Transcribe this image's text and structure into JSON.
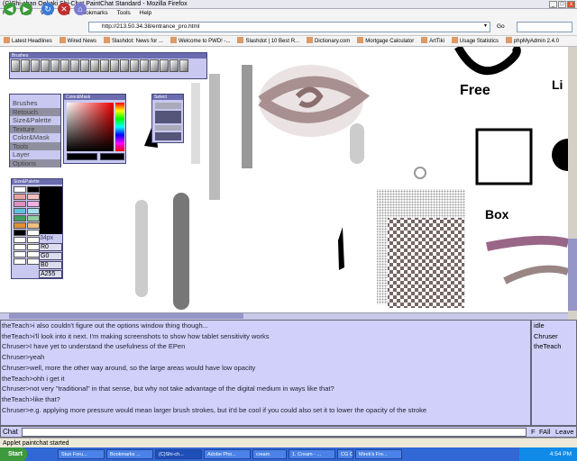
{
  "window": {
    "title": "(C)Shi-chan Oekaki Shi-Chat PaintChat Standard - Mozilla Firefox",
    "min": "_",
    "max": "□",
    "close": "x"
  },
  "menu": [
    "File",
    "Edit",
    "View",
    "Go",
    "Bookmarks",
    "Tools",
    "Help"
  ],
  "address": {
    "url": "http://213.50.34.38/entrance_pro.html",
    "go": "Go"
  },
  "bookmarks": [
    "Latest Headlines",
    "Wired News",
    "Slashdot: News for ...",
    "Welcome to PWD! -...",
    "Slashdot | 10 Best R...",
    "Dictionary.com",
    "Mortgage Calculator",
    "ArtTiki",
    "Usage Statistics",
    "phpMyAdmin 2.4.0"
  ],
  "panels": {
    "brushes_title": "Brushes",
    "color_title": "Color&Mask",
    "select_title": "Select",
    "size_title": "Size&Palette",
    "menu": [
      "Brushes",
      "Retouch",
      "Size&Palette",
      "Texture",
      "Color&Mask",
      "Tools",
      "Layer",
      "Options"
    ],
    "size_label": "34px",
    "rgb": [
      "R0",
      "G0",
      "B0",
      "A255"
    ]
  },
  "canvas_text": {
    "free": "Free",
    "box": "Box",
    "l": "Li"
  },
  "chat": {
    "lines": [
      "theTeach>i also couldn't figure out the options window thing though...",
      "theTeach>i'll look into it next. I'm making screenshots to show how tablet sensitivity works",
      "Chruser>I have yet to understand the usefulness of the EPen",
      "Chruser>yeah",
      "Chruser>well, more the other way around, so the large areas would have low opacity",
      "theTeach>ohh i get it",
      "Chruser>not very \"traditional\" in that sense, but why not take advantage of the digital medium in ways like that?",
      "theTeach>like that?",
      "Chruser>e.g. applying more pressure would mean larger brush strokes, but it'd be cool if you could also set it to lower the opacity of the stroke"
    ],
    "users": [
      "idle",
      "Chruser",
      "theTeach"
    ],
    "label": "Chat",
    "buttons": [
      "F",
      "FAll",
      "Leave"
    ]
  },
  "status": "Applet paintchat started",
  "taskbar": {
    "start": "Start",
    "tasks": [
      "Stun Foru...",
      "Bookmarks ...",
      "(C)Shi-ch...",
      "Adobe Pho...",
      "cream",
      "1. Cream - ...",
      "CG Curricul...",
      "Mirek's Fre..."
    ],
    "clock": "4:54 PM"
  }
}
